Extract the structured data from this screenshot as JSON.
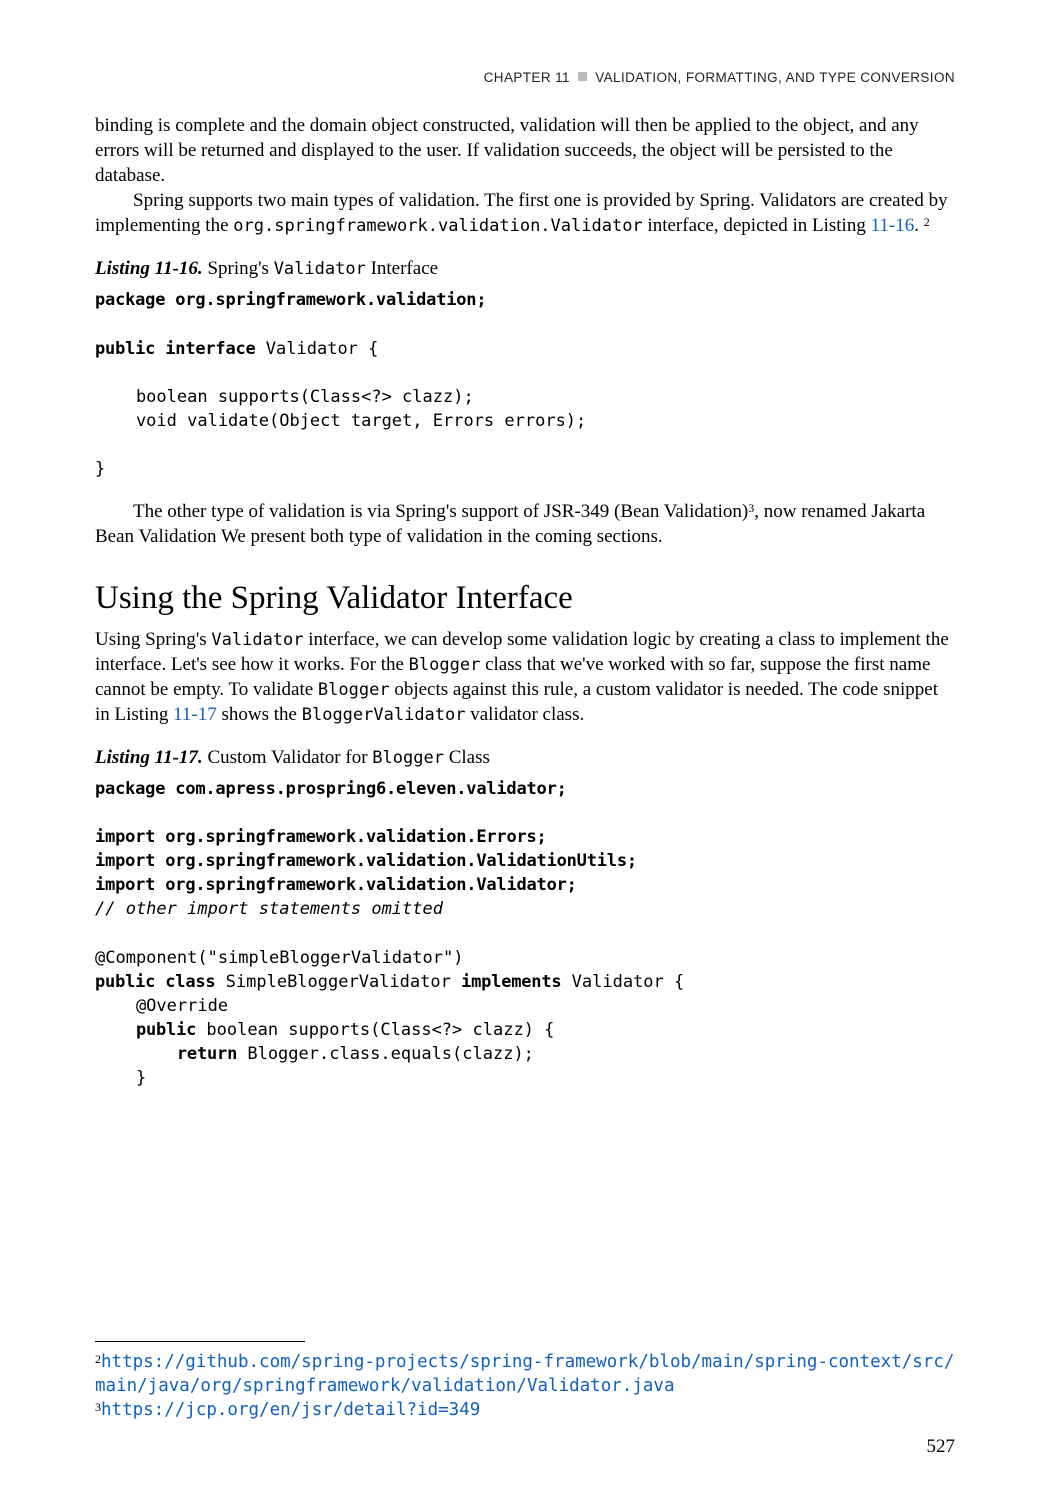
{
  "header": {
    "chapter_label": "CHAPTER 11",
    "chapter_title": "VALIDATION, FORMATTING, AND TYPE CONVERSION"
  },
  "para1": "binding is complete and the domain object constructed, validation will then be applied to the object, and any errors will be returned and displayed to the user. If validation succeeds, the object will be persisted to the database.",
  "para2_a": "Spring supports two main types of validation. The first one is provided by Spring. Validators are created by implementing the ",
  "para2_code": "org.springframework.validation.Validator",
  "para2_b": " interface, depicted in Listing ",
  "para2_link": "11-16",
  "para2_c": ". ",
  "para2_note": "2",
  "listing16": {
    "label": "Listing 11-16.",
    "caption_a": "  Spring's ",
    "caption_code": "Validator",
    "caption_b": " Interface"
  },
  "code16": {
    "l1a": "package",
    "l1b": " org.springframework.validation;",
    "l2a": "public interface",
    "l2b": " Validator {",
    "l3": "    boolean supports(Class<?> clazz);",
    "l4": "    void validate(Object target, Errors errors);",
    "l5": "}"
  },
  "para3_a": "The other type of validation is via Spring's support of JSR-349 (Bean Validation)",
  "para3_note": "3",
  "para3_b": ", now renamed Jakarta Bean Validation We present both type of validation in the coming sections.",
  "section_title": "Using the Spring Validator Interface",
  "para4_a": "Using Spring's ",
  "para4_code1": "Validator",
  "para4_b": " interface, we can develop some validation logic by creating a class to implement the interface. Let's see how it works. For the ",
  "para4_code2": "Blogger",
  "para4_c": " class that we've worked with so far, suppose the first name cannot be empty. To validate ",
  "para4_code3": "Blogger",
  "para4_d": " objects against this rule, a custom validator is needed. The code snippet in Listing ",
  "para4_link": "11-17",
  "para4_e": " shows the ",
  "para4_code4": "BloggerValidator",
  "para4_f": " validator class.",
  "listing17": {
    "label": "Listing 11-17.",
    "caption_a": "  Custom Validator for ",
    "caption_code": "Blogger",
    "caption_b": " Class"
  },
  "code17": {
    "l1a": "package",
    "l1b": " com.apress.prospring6.eleven.validator;",
    "l2a": "import",
    "l2b": " org.springframework.validation.Errors;",
    "l3a": "import",
    "l3b": " org.springframework.validation.ValidationUtils;",
    "l4a": "import",
    "l4b": " org.springframework.validation.Validator;",
    "l5": "// other import statements omitted",
    "l6": "@Component(\"simpleBloggerValidator\")",
    "l7a": "public class",
    "l7b": " SimpleBloggerValidator ",
    "l7c": "implements",
    "l7d": " Validator {",
    "l8": "    @Override",
    "l9a": "    ",
    "l9b": "public",
    "l9c": " boolean supports(Class<?> clazz) {",
    "l10a": "        ",
    "l10b": "return",
    "l10c": " Blogger.class.equals(clazz);",
    "l11": "    }"
  },
  "footnotes": {
    "n2_sup": "2",
    "n2_text": "https://github.com/spring-projects/spring-framework/blob/main/spring-context/src/main/java/org/springframework/validation/Validator.java",
    "n3_sup": "3",
    "n3_text": "https://jcp.org/en/jsr/detail?id=349"
  },
  "page_number": "527"
}
